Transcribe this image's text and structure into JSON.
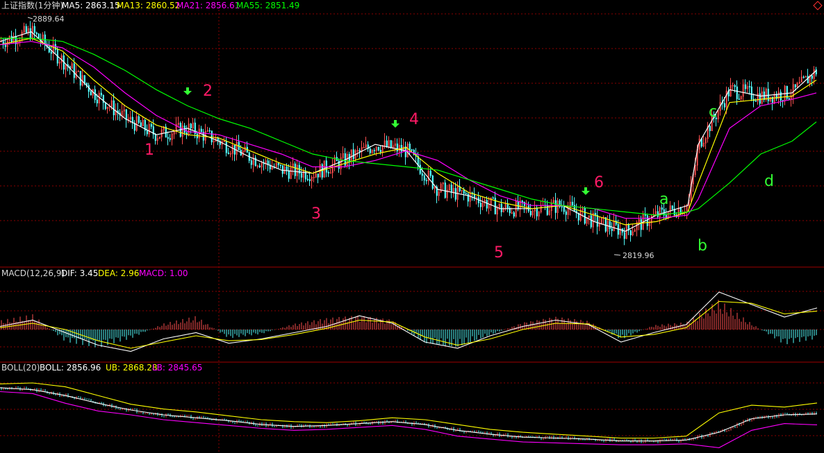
{
  "header_main": {
    "title": "上证指数(1分钟)",
    "ma5": "MA5: 2863.15",
    "ma13": "MA13: 2860.52",
    "ma21": "MA21: 2856.61",
    "ma55": "MA55: 2851.49",
    "corner_icon": "diamond-icon"
  },
  "header_macd": {
    "label": "MACD(12,26,9)",
    "dif": "DIF: 3.45",
    "dea": "DEA: 2.96",
    "macd": "MACD: 1.00"
  },
  "header_boll": {
    "label": "BOLL(20)",
    "boll": "BOLL: 2856.96",
    "ub": "UB: 2868.28",
    "lb": "LB: 2845.65"
  },
  "price_marks": {
    "high": "2889.64",
    "low": "2819.96"
  },
  "annotations": {
    "red_numbers": [
      "1",
      "2",
      "3",
      "4",
      "5",
      "6"
    ],
    "green_letters": [
      "a",
      "b",
      "c",
      "d"
    ]
  },
  "colors": {
    "background": "#000000",
    "grid": "#8b0000",
    "separator": "#a00000",
    "up": "#ff5050",
    "down": "#54ffff",
    "ma5": "#ffffff",
    "ma13": "#ffff00",
    "ma21": "#ff00ff",
    "ma55": "#00ff00",
    "annotation_number": "#ff1a66",
    "annotation_letter": "#33ff33",
    "arrow": "#33ff33"
  },
  "chart_data": [
    {
      "type": "line",
      "title": "上证指数(1分钟)",
      "series": [
        {
          "name": "MA5",
          "x": [
            0,
            45,
            90,
            135,
            180,
            225,
            270,
            315,
            360,
            405,
            450,
            495,
            540,
            585,
            630,
            675,
            720,
            765,
            810,
            855,
            900,
            945,
            990,
            1005,
            1050,
            1095,
            1140,
            1175
          ],
          "values": [
            2884,
            2887,
            2878,
            2868,
            2860,
            2855,
            2857,
            2853,
            2848,
            2844,
            2843,
            2847,
            2852,
            2850,
            2838,
            2836,
            2832,
            2832,
            2833,
            2828,
            2825,
            2830,
            2833,
            2852,
            2869,
            2867,
            2868,
            2875
          ]
        },
        {
          "name": "MA13",
          "values": [
            2883,
            2885,
            2881,
            2872,
            2864,
            2858,
            2855,
            2854,
            2850,
            2846,
            2843,
            2846,
            2849,
            2851,
            2843,
            2837,
            2834,
            2832,
            2833,
            2830,
            2827,
            2828,
            2831,
            2840,
            2865,
            2866,
            2867,
            2872
          ]
        },
        {
          "name": "MA21",
          "values": [
            2883,
            2884,
            2882,
            2876,
            2868,
            2861,
            2856,
            2855,
            2852,
            2849,
            2845,
            2845,
            2847,
            2850,
            2847,
            2841,
            2836,
            2833,
            2833,
            2832,
            2829,
            2829,
            2830,
            2835,
            2857,
            2864,
            2866,
            2868
          ]
        },
        {
          "name": "MA55",
          "values": [
            2885,
            2885,
            2884,
            2880,
            2875,
            2869,
            2864,
            2860,
            2857,
            2853,
            2849,
            2847,
            2846,
            2845,
            2844,
            2841,
            2838,
            2835,
            2833,
            2832,
            2831,
            2830,
            2831,
            2832,
            2840,
            2849,
            2853,
            2859
          ]
        }
      ],
      "price_labels": [
        "2889.64",
        "2819.96"
      ],
      "points_labeled": [
        "1",
        "2",
        "3",
        "4",
        "5",
        "6",
        "a",
        "b",
        "c",
        "d"
      ]
    },
    {
      "type": "bar",
      "title": "MACD(12,26,9)",
      "histogram_trend": [
        0.6,
        1.0,
        -0.8,
        -1.2,
        -0.6,
        0.4,
        0.9,
        -0.6,
        -0.3,
        0.4,
        0.8,
        1.0,
        0.7,
        -1.0,
        -1.3,
        -0.4,
        0.5,
        0.9,
        0.6,
        -0.7,
        0.3,
        0.5,
        2.0,
        0.4,
        -1.0,
        -0.6
      ],
      "series": [
        {
          "name": "DIF",
          "values": [
            0.5,
            1.5,
            -0.5,
            -2.5,
            -3.5,
            -1.5,
            -0.5,
            -2.2,
            -1.5,
            -0.5,
            0.5,
            2.2,
            1.0,
            -2.0,
            -3.0,
            -1.0,
            0.5,
            1.5,
            0.8,
            -2.0,
            -0.5,
            0.8,
            6.0,
            4.0,
            2.0,
            3.45
          ]
        },
        {
          "name": "DEA",
          "values": [
            0.3,
            1.0,
            0.0,
            -1.8,
            -3.0,
            -2.0,
            -1.0,
            -1.8,
            -1.6,
            -0.8,
            0.2,
            1.5,
            1.2,
            -1.2,
            -2.5,
            -1.5,
            0.0,
            1.0,
            0.9,
            -1.2,
            -0.8,
            0.3,
            4.5,
            4.2,
            2.5,
            2.96
          ]
        }
      ]
    },
    {
      "type": "line",
      "title": "BOLL(20)",
      "series": [
        {
          "name": "BOLL",
          "values": [
            2884,
            2882,
            2876,
            2868,
            2861,
            2856,
            2853,
            2850,
            2846,
            2844,
            2845,
            2847,
            2849,
            2846,
            2840,
            2836,
            2833,
            2832,
            2831,
            2829,
            2829,
            2830,
            2838,
            2852,
            2856,
            2856.96
          ]
        },
        {
          "name": "UB",
          "values": [
            2888,
            2889,
            2885,
            2876,
            2867,
            2862,
            2859,
            2855,
            2851,
            2849,
            2848,
            2850,
            2853,
            2851,
            2846,
            2841,
            2838,
            2836,
            2834,
            2832,
            2832,
            2834,
            2858,
            2866,
            2864,
            2868.28
          ]
        },
        {
          "name": "LB",
          "values": [
            2880,
            2878,
            2868,
            2860,
            2856,
            2851,
            2848,
            2845,
            2842,
            2840,
            2841,
            2843,
            2845,
            2841,
            2834,
            2831,
            2828,
            2827,
            2826,
            2825,
            2825,
            2826,
            2822,
            2840,
            2847,
            2845.65
          ]
        }
      ]
    }
  ]
}
